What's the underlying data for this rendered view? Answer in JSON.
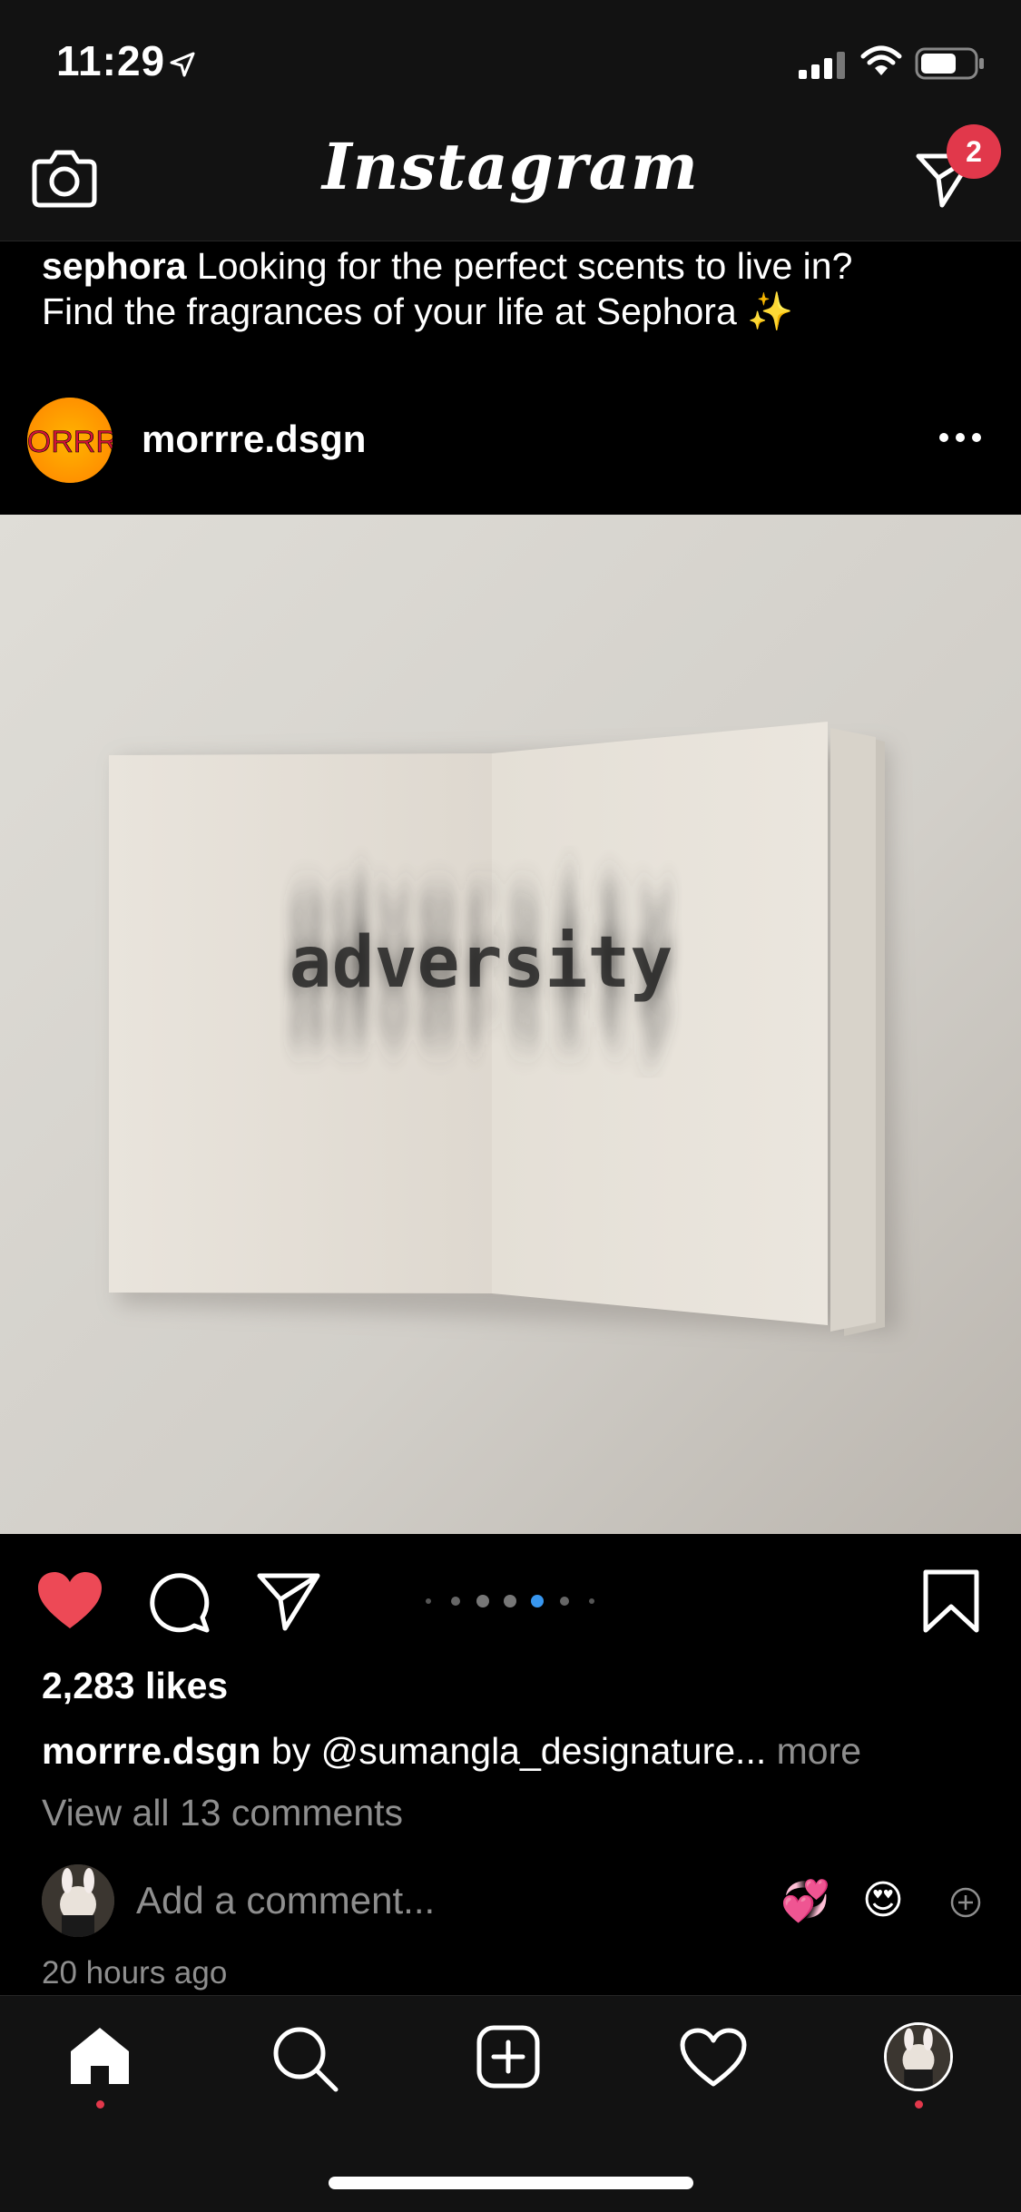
{
  "status_bar": {
    "time": "11:29",
    "icons": [
      "location-arrow-icon",
      "signal-icon",
      "wifi-icon",
      "battery-icon"
    ]
  },
  "header": {
    "camera_icon": "camera-icon",
    "logo": "Instagram",
    "direct_icon": "direct-message-icon",
    "direct_badge": "2"
  },
  "prev_post": {
    "username": "sephora",
    "caption_line1": "Looking for the perfect scents to live in?",
    "caption_line2": "Find the fragrances of your life at Sephora ✨"
  },
  "post": {
    "avatar_text": "MORRRE",
    "username": "morrre.dsgn",
    "image_word": "adversity",
    "carousel": {
      "count": 7,
      "active": 4
    },
    "likes": "2,283 likes",
    "caption_user": "morrre.dsgn",
    "caption_text": " by @sumangla_designature...",
    "caption_more": " more",
    "view_comments": "View all 13 comments",
    "add_comment_placeholder": "Add a comment...",
    "quick_emojis": [
      "💞",
      "😍"
    ],
    "timestamp": "20 hours ago"
  },
  "tab_bar": {
    "items": [
      "home-icon",
      "search-icon",
      "new-post-icon",
      "activity-heart-icon",
      "profile-avatar"
    ]
  },
  "colors": {
    "background": "#000000",
    "bar": "#121212",
    "like_red": "#ed4956",
    "badge_red": "#e1384b",
    "carousel_active": "#3897f0",
    "muted_text": "#8e8e8e"
  }
}
